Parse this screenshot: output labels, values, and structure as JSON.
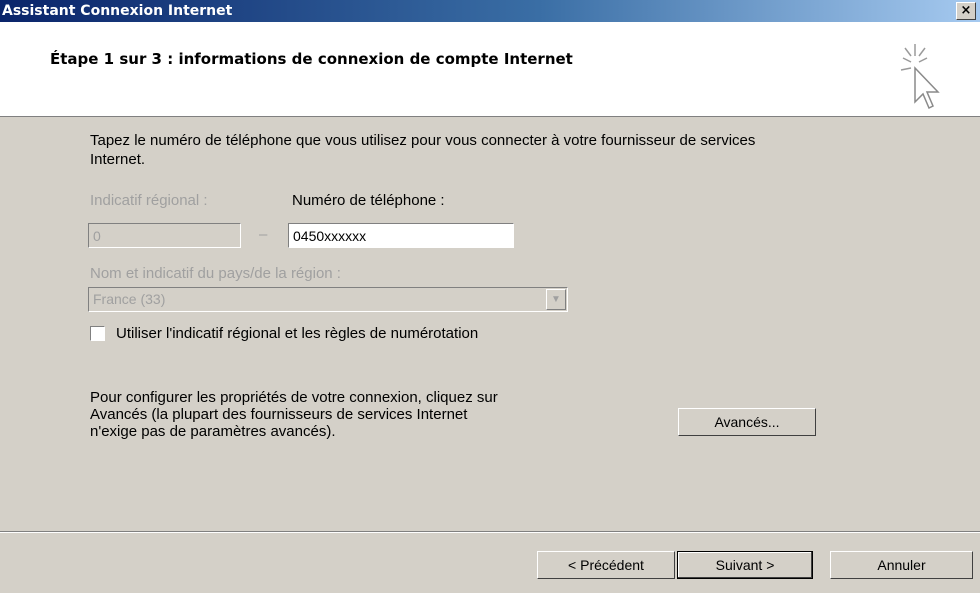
{
  "window": {
    "title": "Assistant Connexion Internet",
    "close_label": "×"
  },
  "header": {
    "title": "Étape 1 sur 3 : informations de connexion de compte Internet",
    "icon": "wizard-cursor-icon"
  },
  "intro_text": "Tapez le numéro de téléphone que vous utilisez pour vous connecter à votre fournisseur de services Internet.",
  "area_code": {
    "label": "Indicatif régional :",
    "value": "0",
    "enabled": false
  },
  "dash": "–",
  "phone": {
    "label": "Numéro de téléphone :",
    "value": "0450xxxxxx"
  },
  "country": {
    "label": "Nom et indicatif du pays/de la région :",
    "value": "France (33)",
    "enabled": false
  },
  "use_area_code": {
    "label": "Utiliser l'indicatif régional et les règles de numérotation",
    "checked": false
  },
  "advanced_text": {
    "line1": "Pour configurer les propriétés de votre connexion, cliquez sur",
    "line2": "Avancés (la plupart des fournisseurs de services Internet",
    "line3": "n'exige pas de paramètres avancés)."
  },
  "buttons": {
    "advanced": "Avancés...",
    "previous": "< Précédent",
    "next": "Suivant >",
    "cancel": "Annuler"
  },
  "colors": {
    "dialog_bg": "#d4d0c8",
    "titlebar_start": "#0a246a",
    "titlebar_end": "#a6caf0",
    "disabled_text": "#a0a0a0"
  }
}
